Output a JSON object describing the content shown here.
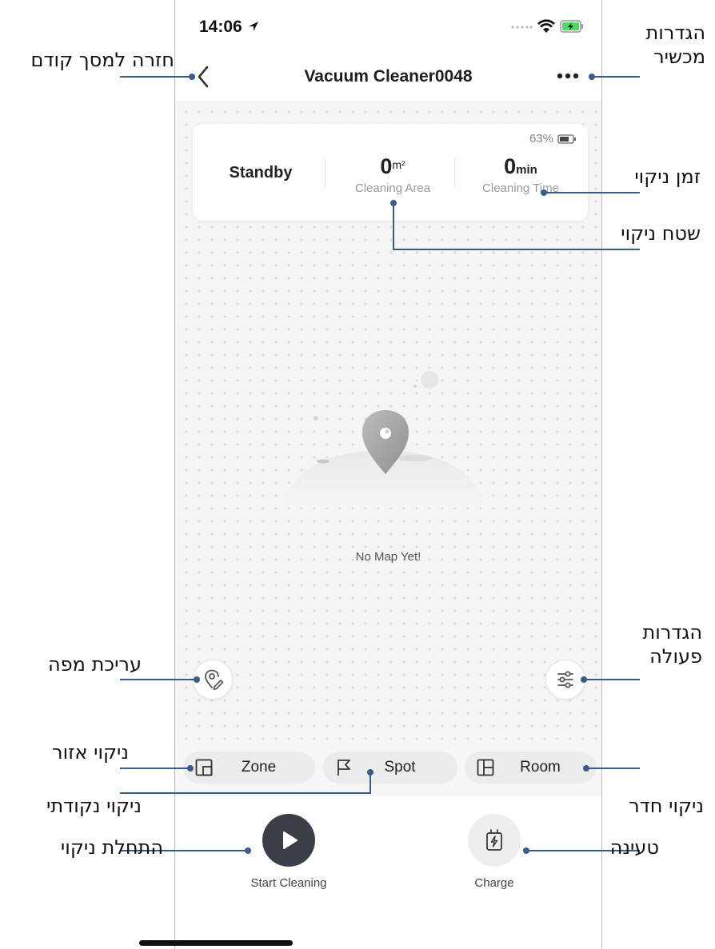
{
  "status_bar": {
    "time": "14:06"
  },
  "header": {
    "title": "Vacuum Cleaner0048"
  },
  "stats": {
    "battery": "63%",
    "status": "Standby",
    "area_value": "0",
    "area_unit": "m²",
    "area_label": "Cleaning Area",
    "time_value": "0",
    "time_unit": "min",
    "time_label": "Cleaning Time"
  },
  "map": {
    "empty_text": "No Map Yet!"
  },
  "modes": [
    {
      "label": "Zone",
      "icon": "zone-icon"
    },
    {
      "label": "Spot",
      "icon": "flag-icon"
    },
    {
      "label": "Room",
      "icon": "room-icon"
    }
  ],
  "actions": {
    "start_label": "Start Cleaning",
    "charge_label": "Charge"
  },
  "annotations": {
    "back": "חזרה למסך קודם",
    "device_settings_1": "הגדרות",
    "device_settings_2": "מכשיר",
    "cleaning_time": "זמן ניקוי",
    "cleaning_area": "שטח ניקוי",
    "map_edit": "עריכת מפה",
    "action_settings_1": "הגדרות",
    "action_settings_2": "פעולה",
    "zone_clean": "ניקוי אזור",
    "spot_clean": "ניקוי נקודתי",
    "room_clean": "ניקוי חדר",
    "start_clean": "התחלת ניקוי",
    "charge": "טעינה"
  },
  "colors": {
    "accent_line": "#3a5a8a",
    "play_button": "#3a3f47",
    "charge_button": "#eeeeee"
  }
}
